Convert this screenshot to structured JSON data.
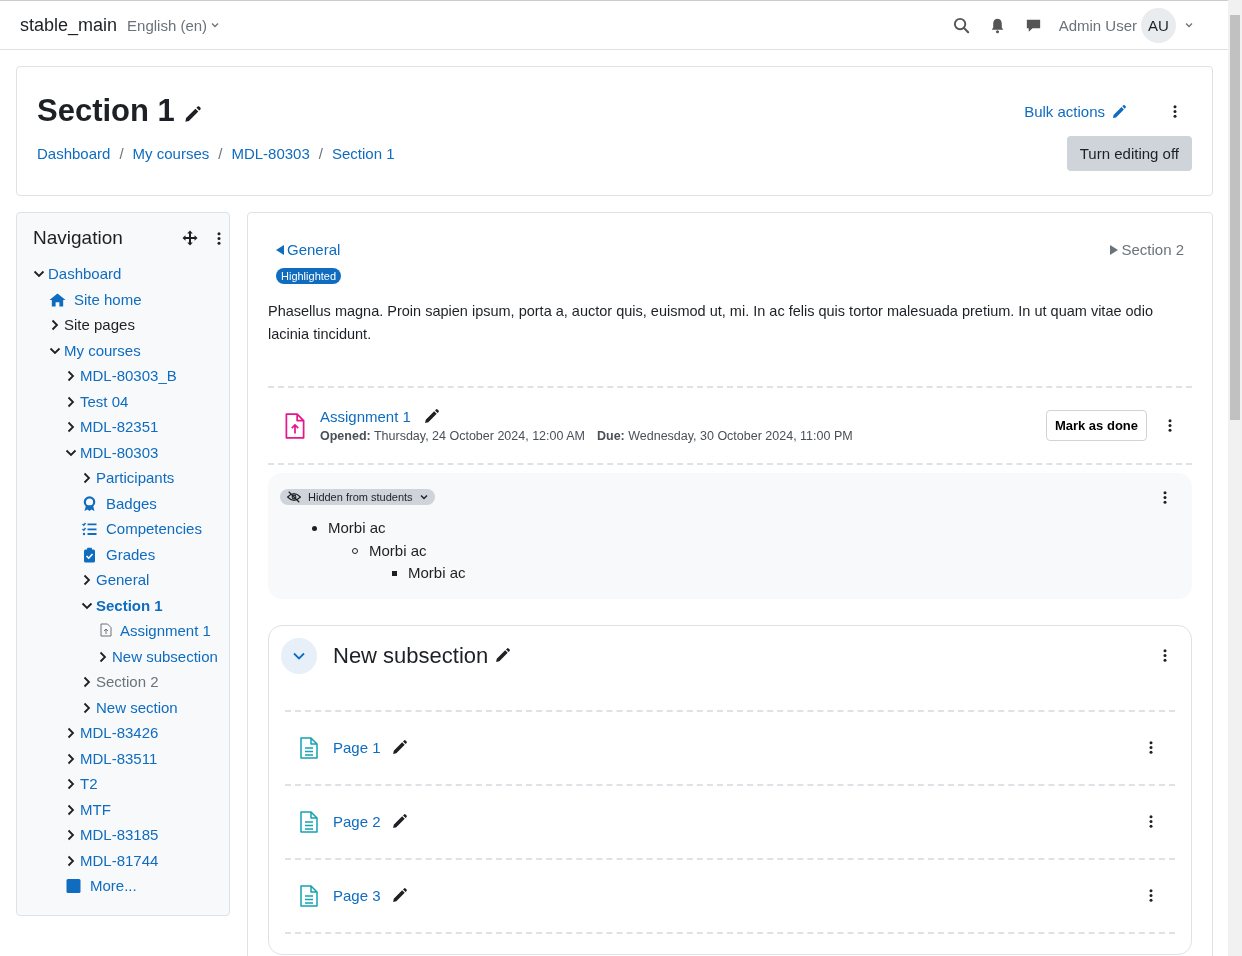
{
  "header": {
    "site_name": "stable_main",
    "language": "English (en)",
    "user_name": "Admin User",
    "user_initials": "AU"
  },
  "page_header": {
    "title": "Section 1",
    "breadcrumbs": [
      {
        "label": "Dashboard"
      },
      {
        "separator": "/",
        "label": "My courses"
      },
      {
        "separator": "/",
        "label": "MDL-80303"
      },
      {
        "separator": "/",
        "label": "Section 1"
      }
    ],
    "bulk_actions": "Bulk actions",
    "edit_button": "Turn editing off"
  },
  "navigation": {
    "title": "Navigation",
    "items": [
      {
        "label": "Dashboard",
        "kind": "branch",
        "link": true,
        "hidden": false,
        "selected": false,
        "expanded": true,
        "children": [
          {
            "label": "Site home",
            "kind": "home",
            "link": true,
            "hidden": false,
            "selected": false
          },
          {
            "label": "Site pages",
            "kind": "branch",
            "link": false,
            "hidden": false,
            "selected": false,
            "expanded": false
          },
          {
            "label": "My courses",
            "kind": "branch",
            "link": true,
            "hidden": false,
            "selected": false,
            "expanded": true,
            "children": [
              {
                "label": "MDL-80303_B",
                "kind": "branch",
                "link": true,
                "hidden": false,
                "selected": false,
                "expanded": false
              },
              {
                "label": "Test 04",
                "kind": "branch",
                "link": true,
                "hidden": false,
                "selected": false,
                "expanded": false
              },
              {
                "label": "MDL-82351",
                "kind": "branch",
                "link": true,
                "hidden": false,
                "selected": false,
                "expanded": false
              },
              {
                "label": "MDL-80303",
                "kind": "branch",
                "link": true,
                "hidden": false,
                "selected": false,
                "expanded": true,
                "children": [
                  {
                    "label": "Participants",
                    "kind": "branch",
                    "link": true,
                    "hidden": false,
                    "selected": false,
                    "expanded": false
                  },
                  {
                    "label": "Badges",
                    "kind": "badge",
                    "link": true,
                    "hidden": false,
                    "selected": false
                  },
                  {
                    "label": "Competencies",
                    "kind": "competencies",
                    "link": true,
                    "hidden": false,
                    "selected": false
                  },
                  {
                    "label": "Grades",
                    "kind": "grades",
                    "link": true,
                    "hidden": false,
                    "selected": false
                  },
                  {
                    "label": "General",
                    "kind": "branch",
                    "link": true,
                    "hidden": false,
                    "selected": false,
                    "expanded": false
                  },
                  {
                    "label": "Section 1",
                    "kind": "branch",
                    "link": true,
                    "hidden": false,
                    "selected": true,
                    "expanded": true,
                    "children": [
                      {
                        "label": "Assignment 1",
                        "kind": "assignment",
                        "link": true,
                        "hidden": false,
                        "selected": false
                      },
                      {
                        "label": "New subsection",
                        "kind": "branch",
                        "link": true,
                        "hidden": false,
                        "selected": false,
                        "expanded": false
                      }
                    ]
                  },
                  {
                    "label": "Section 2",
                    "kind": "branch",
                    "link": true,
                    "hidden": true,
                    "selected": false,
                    "expanded": false
                  },
                  {
                    "label": "New section",
                    "kind": "branch",
                    "link": true,
                    "hidden": false,
                    "selected": false,
                    "expanded": false
                  }
                ]
              },
              {
                "label": "MDL-83426",
                "kind": "branch",
                "link": true,
                "hidden": false,
                "selected": false,
                "expanded": false
              },
              {
                "label": "MDL-83511",
                "kind": "branch",
                "link": true,
                "hidden": false,
                "selected": false,
                "expanded": false
              },
              {
                "label": "T2",
                "kind": "branch",
                "link": true,
                "hidden": false,
                "selected": false,
                "expanded": false
              },
              {
                "label": "MTF",
                "kind": "branch",
                "link": true,
                "hidden": false,
                "selected": false,
                "expanded": false
              },
              {
                "label": "MDL-83185",
                "kind": "branch",
                "link": true,
                "hidden": false,
                "selected": false,
                "expanded": false
              },
              {
                "label": "MDL-81744",
                "kind": "branch",
                "link": true,
                "hidden": false,
                "selected": false,
                "expanded": false
              },
              {
                "label": "More...",
                "kind": "square",
                "link": true,
                "hidden": false,
                "selected": false
              }
            ]
          }
        ]
      }
    ]
  },
  "section": {
    "prev": "General",
    "next": "Section 2",
    "badge": "Highlighted",
    "summary": "Phasellus magna. Proin sapien ipsum, porta a, auctor quis, euismod ut, mi. In ac felis quis tortor malesuada pretium. In ut quam vitae odio lacinia tincidunt.",
    "activities": [
      {
        "kind": "assignment",
        "name": "Assignment 1",
        "dates": [
          {
            "label": "Opened:",
            "value": "Thursday, 24 October 2024, 12:00 AM"
          },
          {
            "label": "Due:",
            "value": "Wednesday, 30 October 2024, 11:00 PM"
          }
        ],
        "completion_button": "Mark as done"
      },
      {
        "kind": "label",
        "visibility": "Hidden from students",
        "items": [
          {
            "text": "Morbi ac",
            "children": [
              {
                "text": "Morbi ac",
                "children": [
                  {
                    "text": "Morbi ac"
                  }
                ]
              }
            ]
          }
        ]
      },
      {
        "kind": "subsection",
        "title": "New subsection",
        "expanded": true,
        "activities": [
          {
            "kind": "page",
            "name": "Page 1"
          },
          {
            "kind": "page",
            "name": "Page 2"
          },
          {
            "kind": "page",
            "name": "Page 3"
          }
        ]
      }
    ]
  }
}
